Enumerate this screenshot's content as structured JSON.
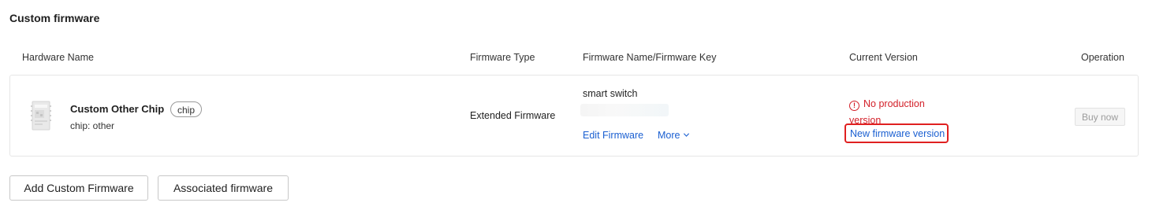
{
  "section": {
    "title": "Custom firmware"
  },
  "table": {
    "headers": {
      "hardware_name": "Hardware Name",
      "firmware_type": "Firmware Type",
      "firmware_name_key": "Firmware Name/Firmware Key",
      "current_version": "Current Version",
      "operation": "Operation"
    },
    "rows": [
      {
        "hardware_name": "Custom Other Chip",
        "tag": "chip",
        "hardware_sub": "chip: other",
        "firmware_type": "Extended Firmware",
        "firmware_name": "smart switch",
        "edit_label": "Edit Firmware",
        "more_label": "More",
        "status_text": "No production version",
        "new_version_label": "New firmware version",
        "buy_label": "Buy now"
      }
    ]
  },
  "actions": {
    "add_custom_firmware": "Add Custom Firmware",
    "associated_firmware": "Associated firmware"
  },
  "colors": {
    "link": "#1a5fd1",
    "error": "#d32029",
    "highlight_border": "#e02020"
  },
  "icons": {
    "status": "error-circle-icon",
    "more": "chevron-down-icon",
    "hardware": "chip-module-icon"
  }
}
